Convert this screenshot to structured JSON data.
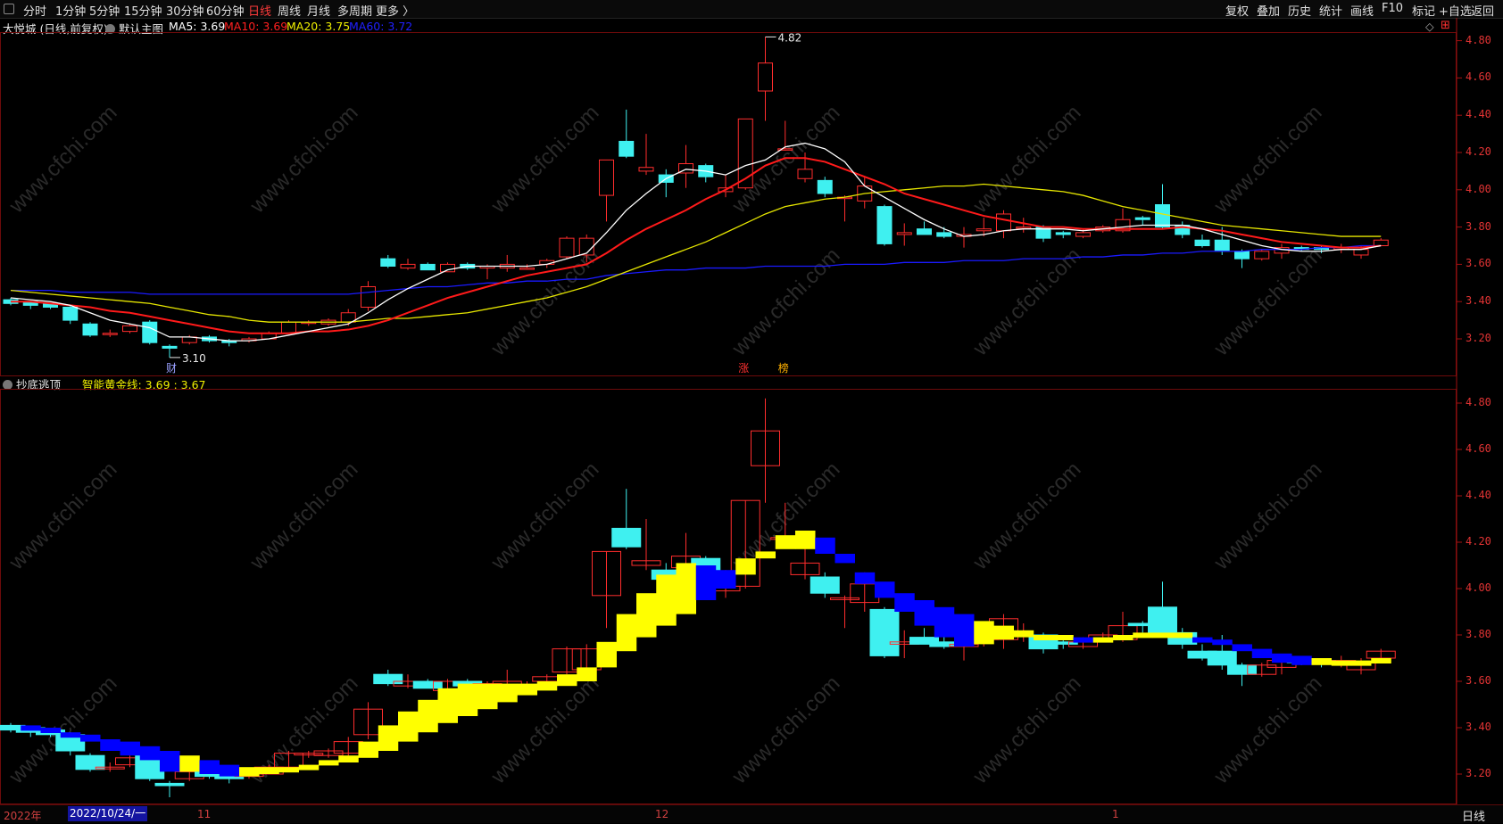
{
  "toolbar": {
    "periods": [
      "分时",
      "1分钟",
      "5分钟",
      "15分钟",
      "30分钟",
      "60分钟",
      "日线",
      "周线",
      "月线",
      "多周期",
      "更多 〉"
    ],
    "active_period": "日线",
    "right_items": [
      "复权",
      "叠加",
      "历史",
      "统计",
      "画线",
      "F10",
      "标记",
      "+自选",
      "返回"
    ]
  },
  "main_panel": {
    "stock": "大悦城 (日线,前复权)",
    "template": "默认主图",
    "ma5_label": "MA5: 3.69",
    "ma10_label": "MA10: 3.69",
    "ma20_label": "MA20: 3.75",
    "ma60_label": "MA60: 3.72",
    "high_marker": "4.82",
    "low_marker": "3.10",
    "events": [
      "财",
      "涨",
      "榜"
    ],
    "y_ticks": [
      "4.80",
      "4.60",
      "4.40",
      "4.20",
      "4.00",
      "3.80",
      "3.60",
      "3.40",
      "3.20"
    ]
  },
  "sub_panel": {
    "indicator": "抄底逃顶",
    "line_label": "智能黄金线: 3.69 : 3.67",
    "y_ticks": [
      "4.80",
      "4.60",
      "4.40",
      "4.20",
      "4.00",
      "3.80",
      "3.60",
      "3.40",
      "3.20"
    ]
  },
  "bottom_bar": {
    "year_label": "2022年",
    "cursor_date": "2022/10/24/一",
    "month_labels": [
      "11",
      "12",
      "1"
    ],
    "period": "日线"
  },
  "colors": {
    "up": "#ff2d2d",
    "down": "#3ff0f0",
    "ma5": "#ffffff",
    "ma10": "#ff1a1a",
    "ma20": "#e6e600",
    "ma60": "#1a1aff",
    "gold": "#ffff00",
    "blue_band": "#0000ff"
  },
  "watermark": "www.cfchi.com",
  "chart_data": {
    "type": "candlestick",
    "candles": [
      [
        3.41,
        3.39,
        3.42,
        3.38
      ],
      [
        3.4,
        3.38,
        3.4,
        3.36
      ],
      [
        3.39,
        3.37,
        3.39,
        3.36
      ],
      [
        3.37,
        3.3,
        3.38,
        3.28
      ],
      [
        3.28,
        3.22,
        3.29,
        3.21
      ],
      [
        3.23,
        3.23,
        3.25,
        3.21
      ],
      [
        3.24,
        3.27,
        3.28,
        3.23
      ],
      [
        3.29,
        3.18,
        3.3,
        3.17
      ],
      [
        3.16,
        3.15,
        3.17,
        3.1
      ],
      [
        3.18,
        3.21,
        3.22,
        3.17
      ],
      [
        3.21,
        3.19,
        3.22,
        3.18
      ],
      [
        3.19,
        3.18,
        3.2,
        3.16
      ],
      [
        3.19,
        3.2,
        3.21,
        3.18
      ],
      [
        3.2,
        3.23,
        3.24,
        3.2
      ],
      [
        3.23,
        3.29,
        3.3,
        3.23
      ],
      [
        3.29,
        3.29,
        3.3,
        3.27
      ],
      [
        3.28,
        3.3,
        3.31,
        3.27
      ],
      [
        3.29,
        3.34,
        3.36,
        3.27
      ],
      [
        3.37,
        3.48,
        3.51,
        3.35
      ],
      [
        3.63,
        3.59,
        3.65,
        3.58
      ],
      [
        3.58,
        3.6,
        3.63,
        3.57
      ],
      [
        3.6,
        3.57,
        3.61,
        3.57
      ],
      [
        3.56,
        3.6,
        3.61,
        3.56
      ],
      [
        3.6,
        3.58,
        3.61,
        3.57
      ],
      [
        3.58,
        3.59,
        3.6,
        3.52
      ],
      [
        3.58,
        3.6,
        3.65,
        3.56
      ],
      [
        3.58,
        3.58,
        3.6,
        3.57
      ],
      [
        3.6,
        3.62,
        3.63,
        3.58
      ],
      [
        3.64,
        3.74,
        3.75,
        3.63
      ],
      [
        3.65,
        3.74,
        3.76,
        3.61
      ],
      [
        3.97,
        4.16,
        4.16,
        3.83
      ],
      [
        4.26,
        4.18,
        4.43,
        4.17
      ],
      [
        4.1,
        4.12,
        4.3,
        4.08
      ],
      [
        4.08,
        4.04,
        4.11,
        3.96
      ],
      [
        4.09,
        4.14,
        4.24,
        4.01
      ],
      [
        4.13,
        4.07,
        4.14,
        4.04
      ],
      [
        3.99,
        4.01,
        4.08,
        3.96
      ],
      [
        4.01,
        4.38,
        4.38,
        4.0
      ],
      [
        4.53,
        4.68,
        4.82,
        4.37
      ],
      [
        4.22,
        4.22,
        4.37,
        4.21
      ],
      [
        4.06,
        4.11,
        4.2,
        4.04
      ],
      [
        4.05,
        3.98,
        4.07,
        3.96
      ],
      [
        3.96,
        3.96,
        3.97,
        3.83
      ],
      [
        3.94,
        4.02,
        4.07,
        3.9
      ],
      [
        3.91,
        3.71,
        3.92,
        3.7
      ],
      [
        3.76,
        3.77,
        3.82,
        3.7
      ],
      [
        3.79,
        3.76,
        3.83,
        3.76
      ],
      [
        3.77,
        3.75,
        3.8,
        3.74
      ],
      [
        3.75,
        3.76,
        3.8,
        3.69
      ],
      [
        3.78,
        3.79,
        3.85,
        3.75
      ],
      [
        3.78,
        3.87,
        3.89,
        3.74
      ],
      [
        3.8,
        3.8,
        3.85,
        3.77
      ],
      [
        3.8,
        3.74,
        3.81,
        3.72
      ],
      [
        3.77,
        3.76,
        3.78,
        3.74
      ],
      [
        3.75,
        3.77,
        3.79,
        3.74
      ],
      [
        3.78,
        3.8,
        3.81,
        3.77
      ],
      [
        3.78,
        3.84,
        3.9,
        3.77
      ],
      [
        3.85,
        3.84,
        3.86,
        3.81
      ],
      [
        3.92,
        3.8,
        4.03,
        3.79
      ],
      [
        3.81,
        3.76,
        3.83,
        3.74
      ],
      [
        3.73,
        3.7,
        3.76,
        3.69
      ],
      [
        3.73,
        3.67,
        3.8,
        3.65
      ],
      [
        3.67,
        3.63,
        3.68,
        3.58
      ],
      [
        3.63,
        3.67,
        3.68,
        3.62
      ],
      [
        3.66,
        3.69,
        3.71,
        3.63
      ],
      [
        3.69,
        3.68,
        3.7,
        3.67
      ],
      [
        3.69,
        3.68,
        3.7,
        3.66
      ],
      [
        3.68,
        3.69,
        3.71,
        3.66
      ],
      [
        3.65,
        3.68,
        3.7,
        3.63
      ],
      [
        3.7,
        3.73,
        3.74,
        3.7
      ]
    ],
    "ma5": [
      3.42,
      3.41,
      3.4,
      3.38,
      3.34,
      3.3,
      3.28,
      3.26,
      3.21,
      3.21,
      3.2,
      3.19,
      3.19,
      3.2,
      3.22,
      3.24,
      3.26,
      3.28,
      3.34,
      3.41,
      3.47,
      3.52,
      3.57,
      3.59,
      3.59,
      3.59,
      3.59,
      3.6,
      3.63,
      3.66,
      3.77,
      3.89,
      3.98,
      4.06,
      4.11,
      4.1,
      4.08,
      4.13,
      4.16,
      4.23,
      4.25,
      4.22,
      4.15,
      4.02,
      3.96,
      3.9,
      3.84,
      3.79,
      3.75,
      3.76,
      3.78,
      3.79,
      3.79,
      3.79,
      3.78,
      3.79,
      3.8,
      3.81,
      3.81,
      3.81,
      3.79,
      3.76,
      3.73,
      3.7,
      3.68,
      3.67,
      3.67,
      3.68,
      3.68,
      3.7
    ],
    "ma10": [
      3.4,
      3.4,
      3.39,
      3.38,
      3.37,
      3.35,
      3.34,
      3.32,
      3.3,
      3.28,
      3.26,
      3.24,
      3.23,
      3.23,
      3.23,
      3.24,
      3.24,
      3.25,
      3.27,
      3.3,
      3.34,
      3.38,
      3.42,
      3.45,
      3.48,
      3.51,
      3.54,
      3.56,
      3.58,
      3.6,
      3.66,
      3.73,
      3.79,
      3.84,
      3.89,
      3.95,
      4.0,
      4.06,
      4.13,
      4.17,
      4.17,
      4.15,
      4.11,
      4.07,
      4.03,
      3.98,
      3.95,
      3.92,
      3.89,
      3.86,
      3.84,
      3.82,
      3.8,
      3.8,
      3.79,
      3.79,
      3.79,
      3.79,
      3.79,
      3.8,
      3.79,
      3.78,
      3.76,
      3.74,
      3.72,
      3.71,
      3.7,
      3.69,
      3.69,
      3.7
    ],
    "ma20": [
      3.46,
      3.45,
      3.44,
      3.43,
      3.42,
      3.41,
      3.4,
      3.39,
      3.37,
      3.35,
      3.33,
      3.32,
      3.3,
      3.29,
      3.29,
      3.29,
      3.29,
      3.29,
      3.3,
      3.31,
      3.31,
      3.32,
      3.33,
      3.34,
      3.36,
      3.38,
      3.4,
      3.42,
      3.45,
      3.48,
      3.52,
      3.56,
      3.6,
      3.64,
      3.68,
      3.72,
      3.77,
      3.82,
      3.87,
      3.91,
      3.93,
      3.95,
      3.96,
      3.98,
      3.99,
      4.0,
      4.01,
      4.02,
      4.02,
      4.03,
      4.02,
      4.01,
      4.0,
      3.99,
      3.97,
      3.94,
      3.91,
      3.89,
      3.87,
      3.85,
      3.83,
      3.81,
      3.8,
      3.79,
      3.78,
      3.77,
      3.76,
      3.75,
      3.75,
      3.75
    ],
    "ma60": [
      3.46,
      3.46,
      3.46,
      3.45,
      3.45,
      3.45,
      3.45,
      3.44,
      3.44,
      3.44,
      3.44,
      3.44,
      3.44,
      3.44,
      3.44,
      3.44,
      3.44,
      3.44,
      3.45,
      3.46,
      3.47,
      3.48,
      3.48,
      3.49,
      3.5,
      3.5,
      3.51,
      3.51,
      3.52,
      3.52,
      3.54,
      3.55,
      3.56,
      3.57,
      3.57,
      3.58,
      3.58,
      3.58,
      3.59,
      3.59,
      3.59,
      3.59,
      3.6,
      3.6,
      3.6,
      3.61,
      3.61,
      3.61,
      3.62,
      3.62,
      3.62,
      3.63,
      3.63,
      3.63,
      3.64,
      3.64,
      3.65,
      3.65,
      3.66,
      3.66,
      3.67,
      3.67,
      3.67,
      3.68,
      3.68,
      3.68,
      3.69,
      3.69,
      3.7,
      3.7
    ]
  }
}
